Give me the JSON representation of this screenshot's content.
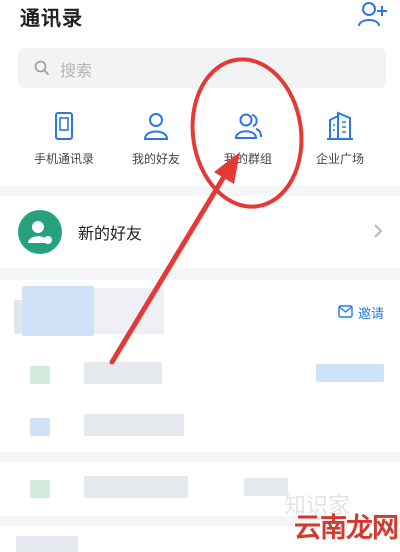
{
  "header": {
    "title": "通讯录"
  },
  "search": {
    "placeholder": "搜索"
  },
  "shortcuts": [
    {
      "label": "手机通讯录",
      "icon": "phone-book-icon"
    },
    {
      "label": "我的好友",
      "icon": "person-icon"
    },
    {
      "label": "我的群组",
      "icon": "group-icon"
    },
    {
      "label": "企业广场",
      "icon": "building-icon"
    }
  ],
  "new_friend": {
    "label": "新的好友",
    "icon": "new-friend-icon"
  },
  "invite": {
    "label": "邀请",
    "icon": "mail-icon"
  },
  "watermark": {
    "text": "云南龙网",
    "faint": "知识家"
  },
  "colors": {
    "accent_blue": "#2b78e4",
    "green_avatar": "#25a27b",
    "annotation_red": "#e53935"
  }
}
